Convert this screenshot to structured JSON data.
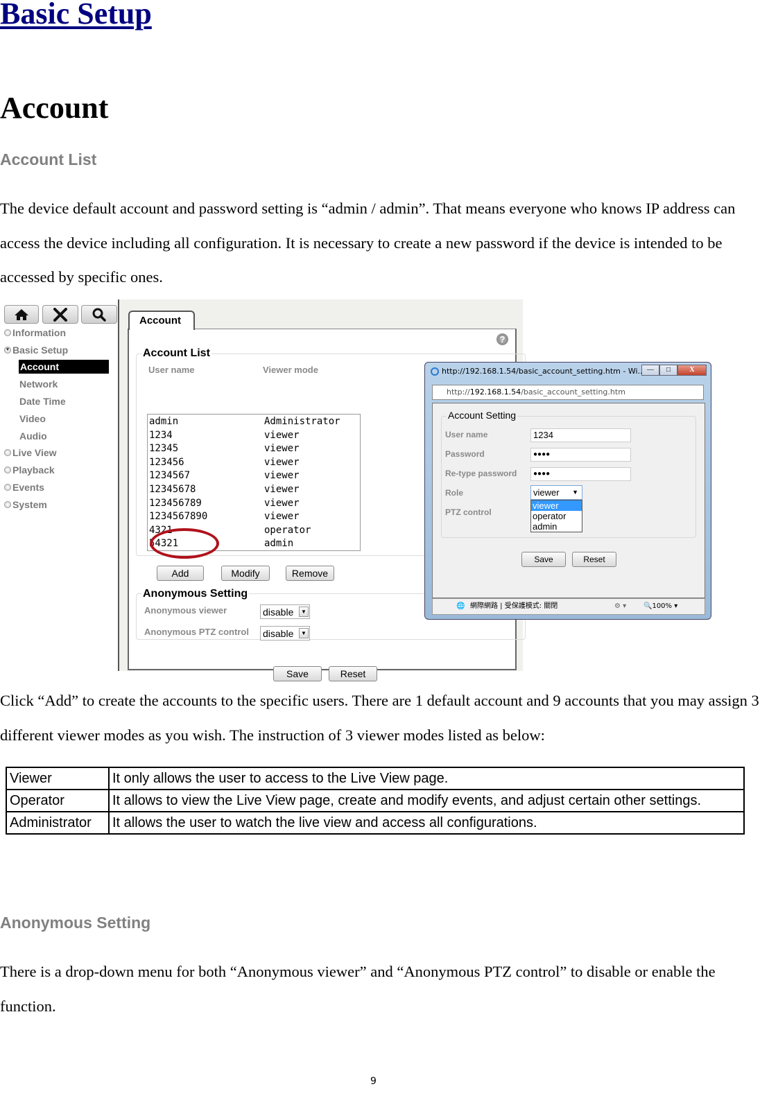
{
  "document": {
    "heading1": "Basic Setup",
    "heading2": "Account",
    "section_account_list": "Account List",
    "para1": "The device default account and password setting is “admin / admin”. That means everyone who knows IP address can access the device including all configuration. It is necessary to create a new password if the device is intended to be accessed by specific ones.",
    "para2": "Click “Add” to create the accounts to the specific users. There are 1 default account and 9 accounts that you may assign 3 different viewer modes as you wish. The instruction of 3 viewer modes listed as below:",
    "section_anonymous": "Anonymous Setting",
    "para3": "There is a drop-down menu for both “Anonymous viewer” and “Anonymous PTZ control” to disable or enable the function.",
    "page_number": "9"
  },
  "modes_table": [
    {
      "mode": "Viewer",
      "description": "It only allows the user to access to the Live View page."
    },
    {
      "mode": "Operator",
      "description": "It allows to view the Live View page, create and modify events, and adjust certain other settings."
    },
    {
      "mode": "Administrator",
      "description": "It allows the user to watch the live view and access all configurations."
    }
  ],
  "screenshot": {
    "toolbar": {
      "home": "home-icon",
      "tools": "tools-icon",
      "search": "search-icon"
    },
    "sidebar": {
      "items": [
        {
          "label": "Information"
        },
        {
          "label": "Basic Setup",
          "expanded": true
        },
        {
          "label": "Live View"
        },
        {
          "label": "Playback"
        },
        {
          "label": "Events"
        },
        {
          "label": "System"
        }
      ],
      "subitems": [
        {
          "label": "Account",
          "active": true
        },
        {
          "label": "Network"
        },
        {
          "label": "Date Time"
        },
        {
          "label": "Video"
        },
        {
          "label": "Audio"
        }
      ]
    },
    "tab_label": "Account",
    "help_glyph": "?",
    "account_list": {
      "legend": "Account List",
      "col_user": "User name",
      "col_mode": "Viewer mode",
      "rows": [
        {
          "user": "admin",
          "mode": "Administrator"
        },
        {
          "user": "1234",
          "mode": "viewer"
        },
        {
          "user": "12345",
          "mode": "viewer"
        },
        {
          "user": "123456",
          "mode": "viewer"
        },
        {
          "user": "1234567",
          "mode": "viewer"
        },
        {
          "user": "12345678",
          "mode": "viewer"
        },
        {
          "user": "123456789",
          "mode": "viewer"
        },
        {
          "user": "1234567890",
          "mode": "viewer"
        },
        {
          "user": "4321",
          "mode": "operator"
        },
        {
          "user": "54321",
          "mode": "admin"
        }
      ],
      "add": "Add",
      "modify": "Modify",
      "remove": "Remove"
    },
    "anonymous": {
      "legend": "Anonymous Setting",
      "viewer_label": "Anonymous viewer",
      "viewer_value": "disable",
      "ptz_label": "Anonymous PTZ control",
      "ptz_value": "disable"
    },
    "save": "Save",
    "reset": "Reset",
    "highlight_color": "#b0121b"
  },
  "popup": {
    "title": "http://192.168.1.54/basic_account_setting.htm - Wi...",
    "url_prefix": "http://",
    "url_host": "192.168.1.54",
    "url_path": "/basic_account_setting.htm",
    "legend": "Account Setting",
    "user_label": "User name",
    "user_value": "1234",
    "password_label": "Password",
    "password_value": "●●●●",
    "retype_label": "Re-type password",
    "retype_value": "●●●●",
    "role_label": "Role",
    "role_value": "viewer",
    "role_options": [
      "viewer",
      "operator",
      "admin"
    ],
    "ptz_label": "PTZ control",
    "save": "Save",
    "reset": "Reset",
    "status_zone": "網際網路 | 受保護模式: 關閉",
    "zoom": "100%",
    "window_buttons": {
      "minimize": "—",
      "maximize": "□",
      "close": "X"
    }
  }
}
